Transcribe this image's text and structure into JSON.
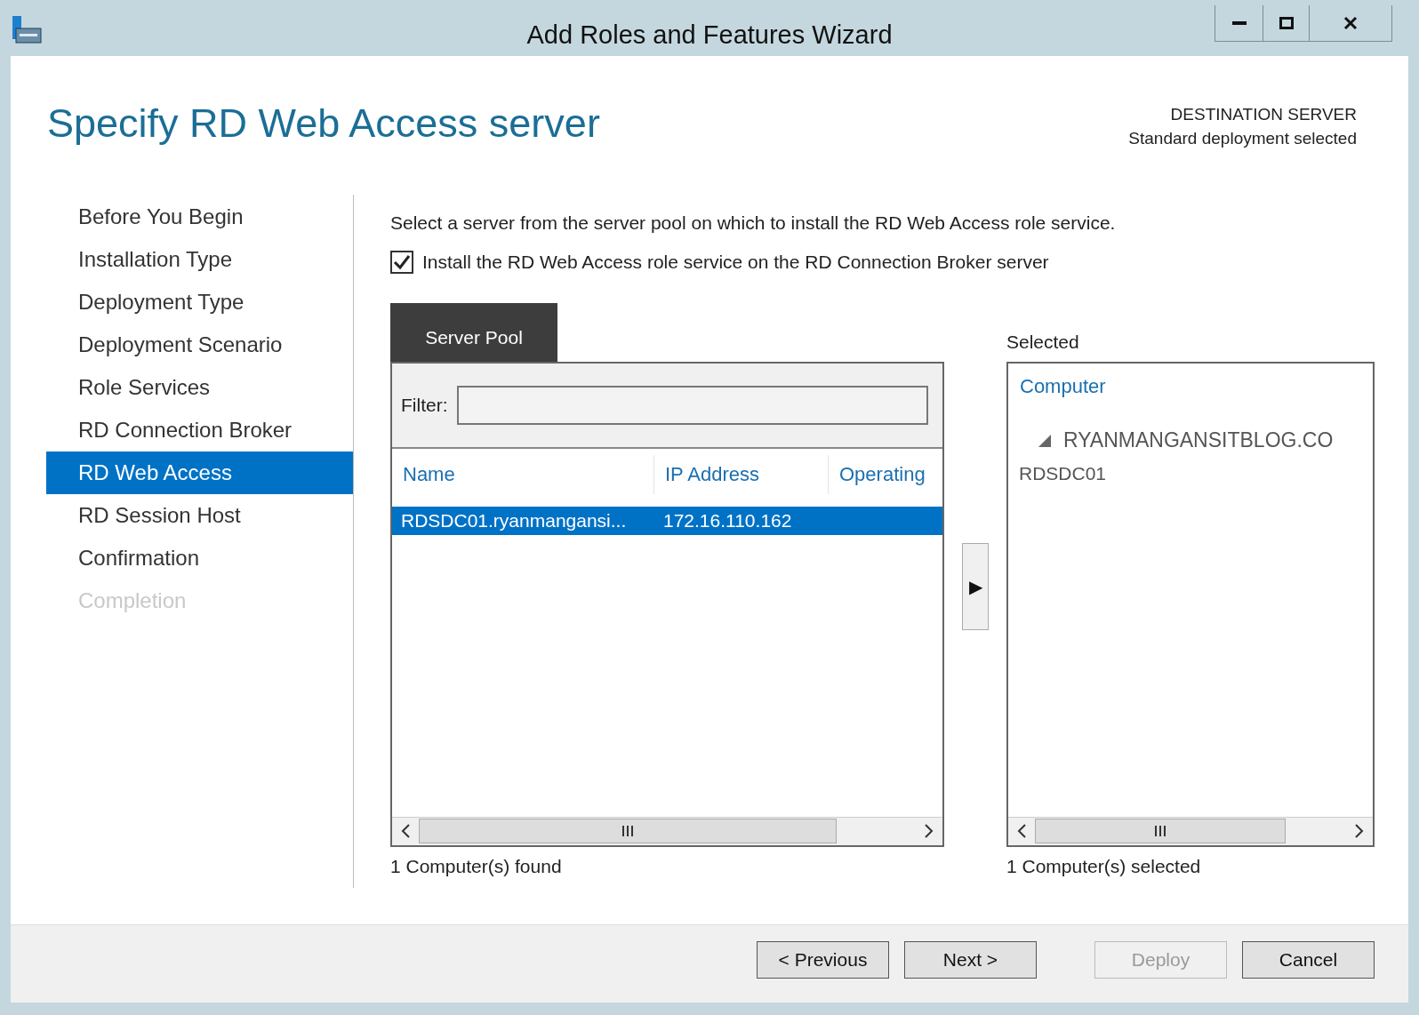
{
  "window": {
    "title": "Add Roles and Features Wizard"
  },
  "page_title": "Specify RD Web Access server",
  "destination": {
    "label": "DESTINATION SERVER",
    "value": "Standard deployment selected"
  },
  "steps": [
    {
      "label": "Before You Begin",
      "selected": false,
      "disabled": false
    },
    {
      "label": "Installation Type",
      "selected": false,
      "disabled": false
    },
    {
      "label": "Deployment Type",
      "selected": false,
      "disabled": false
    },
    {
      "label": "Deployment Scenario",
      "selected": false,
      "disabled": false
    },
    {
      "label": "Role Services",
      "selected": false,
      "disabled": false
    },
    {
      "label": "RD Connection Broker",
      "selected": false,
      "disabled": false
    },
    {
      "label": "RD Web Access",
      "selected": true,
      "disabled": false
    },
    {
      "label": "RD Session Host",
      "selected": false,
      "disabled": false
    },
    {
      "label": "Confirmation",
      "selected": false,
      "disabled": false
    },
    {
      "label": "Completion",
      "selected": false,
      "disabled": true
    }
  ],
  "description": "Select a server from the server pool on which to install the RD Web Access role service.",
  "install_checkbox": {
    "label": "Install the RD Web Access role service on the RD Connection Broker server",
    "checked": true
  },
  "server_pool": {
    "tab": "Server Pool",
    "filter_label": "Filter:",
    "columns": [
      "Name",
      "IP Address",
      "Operating"
    ],
    "rows": [
      {
        "cells": [
          "RDSDC01.ryanmangansi...",
          "172.16.110.162"
        ],
        "selected": true
      }
    ],
    "status": "1 Computer(s) found"
  },
  "add_button": {
    "label": "▶"
  },
  "selected_panel": {
    "label": "Selected",
    "column": "Computer",
    "groups": [
      {
        "label": "RYANMANGANSITBLOG.CO",
        "expanded": true,
        "children": [
          {
            "label": "RDSDC01"
          }
        ]
      }
    ],
    "status": "1 Computer(s) selected"
  },
  "buttons": [
    {
      "label": "< Previous",
      "disabled": false
    },
    {
      "label": "Next >",
      "disabled": false
    },
    {
      "label": "Deploy",
      "disabled": true
    },
    {
      "label": "Cancel",
      "disabled": false
    }
  ]
}
